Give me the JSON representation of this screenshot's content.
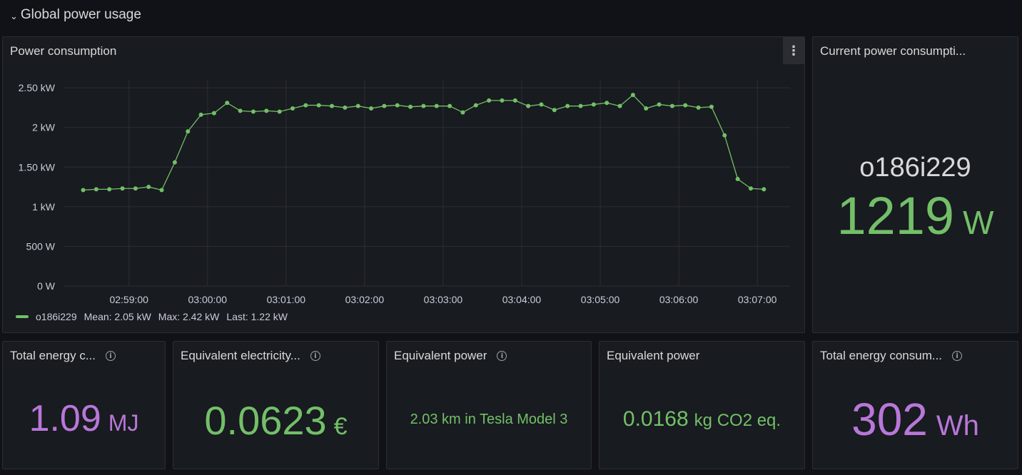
{
  "row": {
    "chevron": "⌄",
    "title": "Global power usage"
  },
  "panels": {
    "chart": {
      "title": "Power consumption",
      "menu_icon": "⋮"
    },
    "current": {
      "title": "Current power consumpti...",
      "label": "o186i229",
      "value": "1219",
      "unit": "W"
    },
    "energy_mj": {
      "title": "Total energy c...",
      "value": "1.09",
      "unit": "MJ"
    },
    "electricity": {
      "title": "Equivalent electricity...",
      "value": "0.0623",
      "unit": "€"
    },
    "tesla": {
      "title": "Equivalent power",
      "value": "2.03 km in Tesla Model 3"
    },
    "co2": {
      "title": "Equivalent power",
      "value": "0.0168",
      "unit": "kg CO2 eq."
    },
    "energy_wh": {
      "title": "Total energy consum...",
      "value": "302",
      "unit": "Wh"
    }
  },
  "legend": {
    "series": "o186i229",
    "mean": "Mean: 2.05 kW",
    "max": "Max: 2.42 kW",
    "last": "Last: 1.22 kW"
  },
  "colors": {
    "green": "#73bf69",
    "purple": "#b877d9",
    "background": "#111217",
    "panel": "#181b1f"
  },
  "chart_data": {
    "type": "line",
    "title": "Power consumption",
    "ylim": [
      0,
      2.6
    ],
    "y_ticks": [
      0,
      0.5,
      1,
      1.5,
      2,
      2.5
    ],
    "y_tick_labels": [
      "0 W",
      "500 W",
      "1 kW",
      "1.50 kW",
      "2 kW",
      "2.50 kW"
    ],
    "x_tick_labels": [
      "02:59:00",
      "03:00:00",
      "03:01:00",
      "03:02:00",
      "03:03:00",
      "03:04:00",
      "03:05:00",
      "03:06:00",
      "03:07:00"
    ],
    "x_start": "02:58:25",
    "x_step_seconds": 10,
    "series": [
      {
        "name": "o186i229",
        "values": [
          1.21,
          1.22,
          1.22,
          1.23,
          1.23,
          1.25,
          1.21,
          1.56,
          1.95,
          2.16,
          2.18,
          2.31,
          2.21,
          2.2,
          2.21,
          2.2,
          2.24,
          2.28,
          2.28,
          2.27,
          2.25,
          2.27,
          2.24,
          2.27,
          2.28,
          2.26,
          2.27,
          2.27,
          2.27,
          2.19,
          2.28,
          2.34,
          2.34,
          2.34,
          2.27,
          2.29,
          2.22,
          2.27,
          2.27,
          2.29,
          2.31,
          2.27,
          2.41,
          2.24,
          2.29,
          2.27,
          2.28,
          2.25,
          2.26,
          1.9,
          1.35,
          1.23,
          1.22
        ]
      }
    ]
  }
}
